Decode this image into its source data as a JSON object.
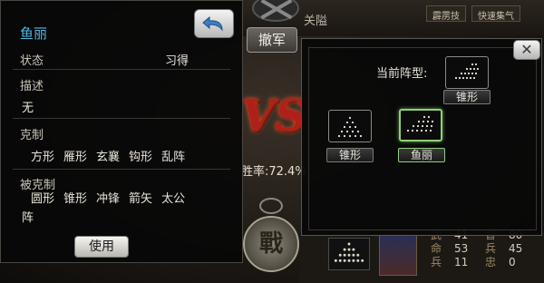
{
  "background": {
    "pass_label": "关隘",
    "top_tabs": [
      "霹雳技",
      "快速集气"
    ],
    "retreat_label": "撤军",
    "vs_label": "VS",
    "win_rate": "胜率:72.4%",
    "battle_label": "戰",
    "stats": [
      {
        "label": "武",
        "value": "41",
        "label2": "智",
        "value2": "80"
      },
      {
        "label": "命",
        "value": "53",
        "label2": "兵",
        "value2": "45"
      },
      {
        "label": "兵",
        "value": "11",
        "label2": "忠",
        "value2": "0"
      }
    ]
  },
  "info_panel": {
    "title": "鱼丽",
    "status_label": "状态",
    "status_value": "习得",
    "desc_label": "描述",
    "desc_value": "无",
    "counter_label": "克制",
    "counters": [
      "方形",
      "雁形",
      "玄襄",
      "钩形",
      "乱阵"
    ],
    "countered_label": "被克制",
    "countered_by": [
      "圆形",
      "锥形",
      "冲锋",
      "箭矢",
      "太公",
      "阵"
    ],
    "use_button": "使用"
  },
  "formation_panel": {
    "current_label": "当前阵型:",
    "current_formation": "锥形",
    "options": [
      {
        "label": "锥形",
        "selected": false
      },
      {
        "label": "鱼丽",
        "selected": true
      }
    ],
    "close_icon": "x-icon"
  },
  "colors": {
    "title_blue": "#4fb8e0",
    "selected_green": "#8fd07a",
    "vs_red": "#b0201a"
  }
}
